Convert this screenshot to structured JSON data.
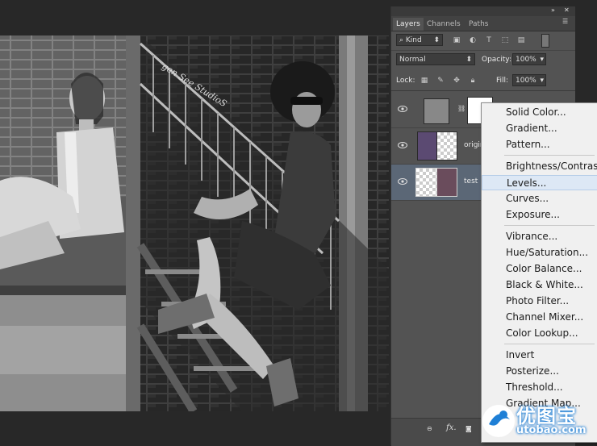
{
  "panel": {
    "tabs": [
      {
        "label": "Layers"
      },
      {
        "label": "Channels"
      },
      {
        "label": "Paths"
      }
    ],
    "filter_kind": "Kind",
    "blend_mode": "Normal",
    "opacity_label": "Opacity:",
    "opacity_value": "100%",
    "lock_label": "Lock:",
    "fill_label": "Fill:",
    "fill_value": "100%",
    "layers": [
      {
        "name": ""
      },
      {
        "name": "origin"
      },
      {
        "name": "test"
      }
    ],
    "footer_fx": "fx."
  },
  "photo": {
    "watermark_text": "gen See StudioS"
  },
  "menu": {
    "items": [
      {
        "label": "Solid Color..."
      },
      {
        "label": "Gradient..."
      },
      {
        "label": "Pattern..."
      },
      {
        "label": "Brightness/Contrast..."
      },
      {
        "label": "Levels..."
      },
      {
        "label": "Curves..."
      },
      {
        "label": "Exposure..."
      },
      {
        "label": "Vibrance..."
      },
      {
        "label": "Hue/Saturation..."
      },
      {
        "label": "Color Balance..."
      },
      {
        "label": "Black & White..."
      },
      {
        "label": "Photo Filter..."
      },
      {
        "label": "Channel Mixer..."
      },
      {
        "label": "Color Lookup..."
      },
      {
        "label": "Invert"
      },
      {
        "label": "Posterize..."
      },
      {
        "label": "Threshold..."
      },
      {
        "label": "Gradient Map..."
      }
    ],
    "highlighted_index": 4
  },
  "watermark": {
    "brand": "优图宝",
    "url": "utobao.com"
  },
  "colors": {
    "panel_bg": "#535353",
    "menu_bg": "#f0f0f0",
    "menu_highlight": "#dde8f5",
    "brand_blue": "#1e7fd6"
  }
}
